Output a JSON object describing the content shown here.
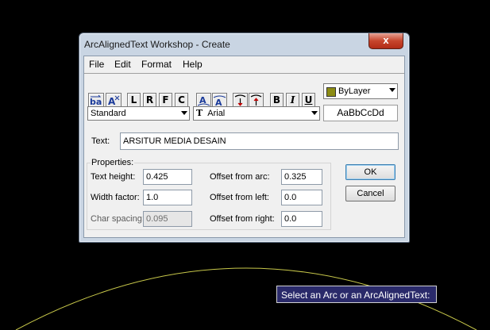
{
  "dialog": {
    "title": "ArcAlignedText Workshop - Create",
    "close_label": "x"
  },
  "menu": {
    "file": "File",
    "edit": "Edit",
    "format": "Format",
    "help": "Help"
  },
  "toolbar": {
    "left_label": "L",
    "right_label": "R",
    "fit_label": "F",
    "center_label": "C",
    "bold_label": "B",
    "italic_label": "I",
    "underline_label": "U",
    "color_label": "ByLayer",
    "color_swatch": "#8c8c14"
  },
  "style_select": {
    "value": "Standard"
  },
  "font_select": {
    "value": "Arial",
    "icon": "truetype-icon"
  },
  "preview": {
    "text": "AaBbCcDd"
  },
  "text_field": {
    "label": "Text:",
    "value": "ARSITUR MEDIA DESAIN"
  },
  "properties": {
    "group_label": "Properties:",
    "text_height_label": "Text height:",
    "text_height_value": "0.425",
    "width_factor_label": "Width factor:",
    "width_factor_value": "1.0",
    "char_spacing_label": "Char spacing:",
    "char_spacing_value": "0.095",
    "offset_arc_label": "Offset from arc:",
    "offset_arc_value": "0.325",
    "offset_left_label": "Offset from left:",
    "offset_left_value": "0.0",
    "offset_right_label": "Offset from right:",
    "offset_right_value": "0.0"
  },
  "buttons": {
    "ok": "OK",
    "cancel": "Cancel"
  },
  "tooltip": {
    "text": "Select an Arc or an ArcAlignedText:"
  },
  "colors": {
    "arc": "#c8c84a",
    "background": "#000000"
  }
}
